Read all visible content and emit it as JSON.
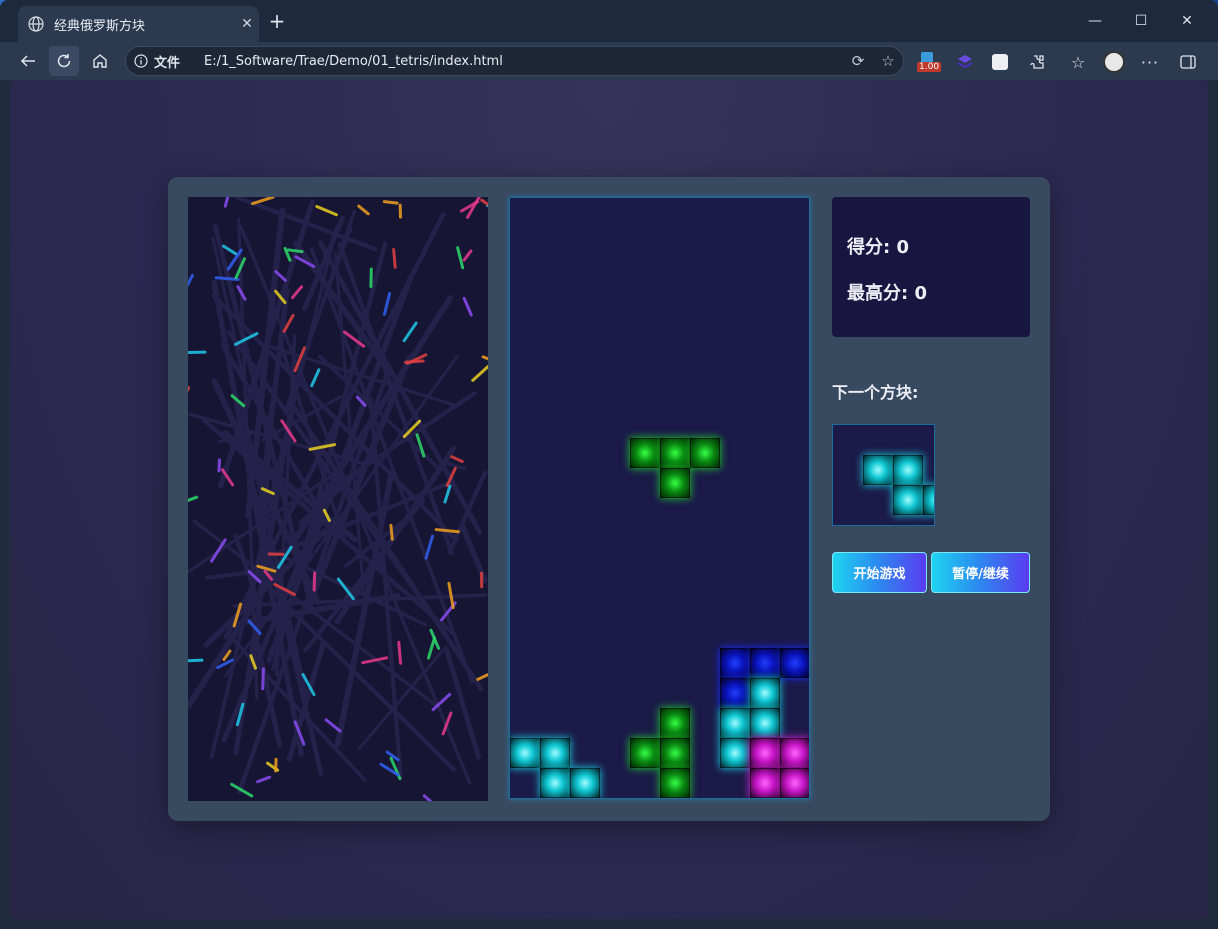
{
  "browser": {
    "tab_title": "经典俄罗斯方块",
    "tab_close": "✕",
    "new_tab": "+",
    "info_label": "文件",
    "url": "E:/1_Software/Trae/Demo/01_tetris/index.html",
    "badge_value": "1.00",
    "icons": [
      "back-icon",
      "refresh-icon",
      "home-icon",
      "info-icon",
      "read-aloud-icon",
      "favorite-star-icon",
      "extension-icons",
      "favorites-icon",
      "profile-icon",
      "more-icon",
      "sidebar-icon"
    ]
  },
  "game": {
    "score_label": "得分:",
    "score_value": "0",
    "high_label": "最高分:",
    "high_value": "0",
    "next_label": "下一个方块:",
    "start_button": "开始游戏",
    "pause_button": "暂停/继续",
    "board": {
      "cols": 10,
      "rows": 20,
      "cells": [
        {
          "c": 4,
          "r": 8,
          "color": "green"
        },
        {
          "c": 5,
          "r": 8,
          "color": "green"
        },
        {
          "c": 6,
          "r": 8,
          "color": "green"
        },
        {
          "c": 5,
          "r": 9,
          "color": "green"
        },
        {
          "c": 7,
          "r": 15,
          "color": "blue"
        },
        {
          "c": 8,
          "r": 15,
          "color": "blue"
        },
        {
          "c": 9,
          "r": 15,
          "color": "blue"
        },
        {
          "c": 7,
          "r": 16,
          "color": "blue"
        },
        {
          "c": 8,
          "r": 16,
          "color": "cyan"
        },
        {
          "c": 5,
          "r": 17,
          "color": "green"
        },
        {
          "c": 7,
          "r": 17,
          "color": "cyan"
        },
        {
          "c": 8,
          "r": 17,
          "color": "cyan"
        },
        {
          "c": 0,
          "r": 18,
          "color": "cyan"
        },
        {
          "c": 1,
          "r": 18,
          "color": "cyan"
        },
        {
          "c": 4,
          "r": 18,
          "color": "green"
        },
        {
          "c": 5,
          "r": 18,
          "color": "green"
        },
        {
          "c": 7,
          "r": 18,
          "color": "cyan"
        },
        {
          "c": 8,
          "r": 18,
          "color": "magenta"
        },
        {
          "c": 9,
          "r": 18,
          "color": "magenta"
        },
        {
          "c": 1,
          "r": 19,
          "color": "cyan"
        },
        {
          "c": 2,
          "r": 19,
          "color": "cyan"
        },
        {
          "c": 5,
          "r": 19,
          "color": "green"
        },
        {
          "c": 8,
          "r": 19,
          "color": "magenta"
        },
        {
          "c": 9,
          "r": 19,
          "color": "magenta"
        }
      ]
    },
    "next_piece": {
      "cells": [
        {
          "c": 1,
          "r": 1,
          "color": "cyan"
        },
        {
          "c": 2,
          "r": 1,
          "color": "cyan"
        },
        {
          "c": 2,
          "r": 2,
          "color": "cyan"
        },
        {
          "c": 3,
          "r": 2,
          "color": "cyan"
        }
      ]
    },
    "colors": {
      "green": "#1fd42c",
      "cyan": "#18d8e4",
      "blue": "#1a2cff",
      "magenta": "#e022e0"
    }
  }
}
